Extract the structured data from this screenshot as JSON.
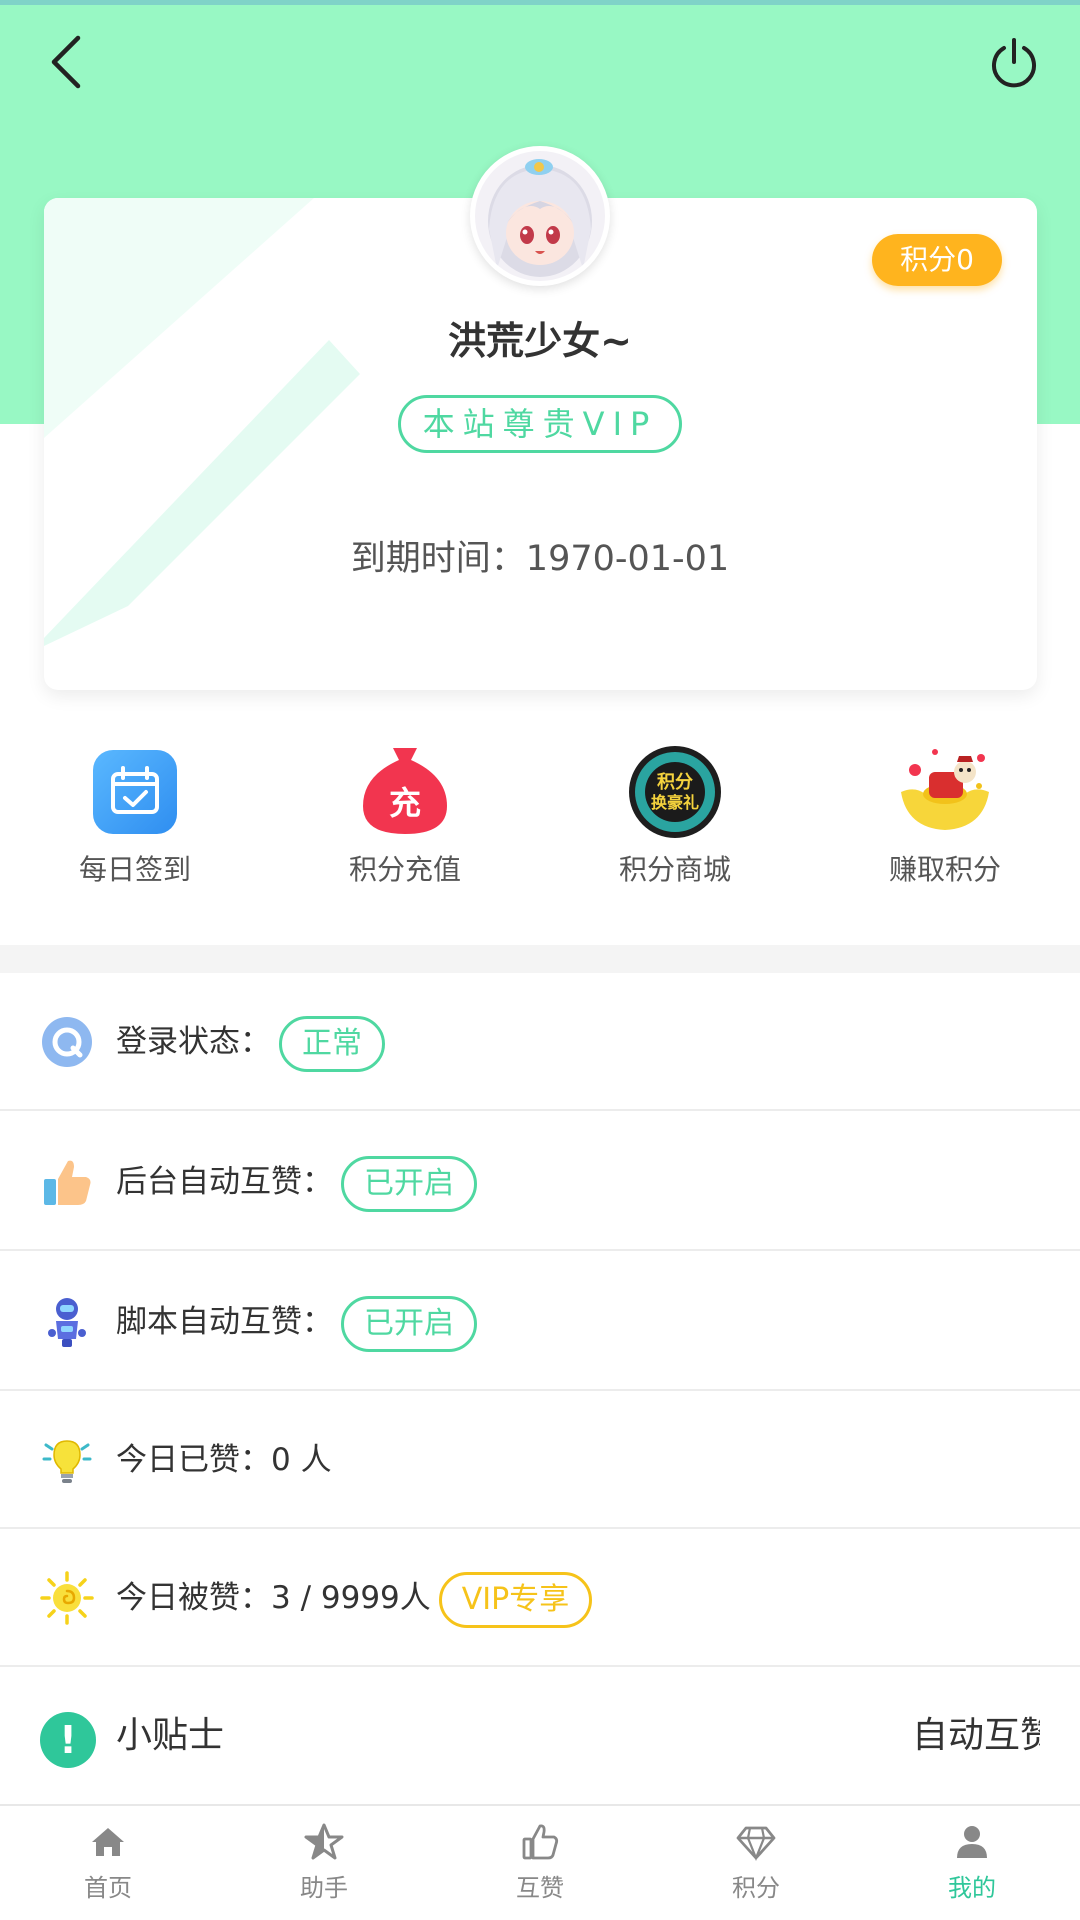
{
  "colors": {
    "hero_bg": "#98f8c4",
    "accent_green": "#4fd8a1",
    "points_badge": "#ffb41e",
    "vip_gold": "#f6c31a",
    "tab_active": "#2fc79a"
  },
  "header": {
    "back_icon": "chevron-left-icon",
    "power_icon": "power-icon"
  },
  "profile": {
    "avatar_icon": "anime-girl-avatar",
    "points_badge": "积分0",
    "username": "洪荒少女~",
    "vip_tag": "本站尊贵VIP",
    "expiry_label": "到期时间：",
    "expiry_value": "1970-01-01"
  },
  "quick_actions": [
    {
      "label": "每日签到",
      "icon": "calendar-check-icon"
    },
    {
      "label": "积分充值",
      "icon": "recharge-bag-icon"
    },
    {
      "label": "积分商城",
      "icon": "points-mall-icon"
    },
    {
      "label": "赚取积分",
      "icon": "gold-ingot-icon"
    }
  ],
  "status_rows": [
    {
      "label": "登录状态：",
      "icon": "q-circle-icon",
      "pill": "正常"
    },
    {
      "label": "后台自动互赞：",
      "icon": "thumbs-up-icon",
      "pill": "已开启"
    },
    {
      "label": "脚本自动互赞：",
      "icon": "robot-icon",
      "pill": "已开启"
    },
    {
      "label": "今日已赞：",
      "icon": "lightbulb-icon",
      "value": "0 人"
    },
    {
      "label": "今日被赞：",
      "icon": "sun-icon",
      "value": "3 / 9999人",
      "pill": "VIP专享"
    }
  ],
  "tips": {
    "icon": "exclamation-circle-icon",
    "title": "小贴士",
    "marquee": "自动互赞"
  },
  "tabbar": [
    {
      "label": "首页",
      "icon": "home-icon",
      "active": false
    },
    {
      "label": "助手",
      "icon": "star-icon",
      "active": false
    },
    {
      "label": "互赞",
      "icon": "thumbs-up-icon",
      "active": false
    },
    {
      "label": "积分",
      "icon": "diamond-icon",
      "active": false
    },
    {
      "label": "我的",
      "icon": "user-icon",
      "active": true
    }
  ]
}
